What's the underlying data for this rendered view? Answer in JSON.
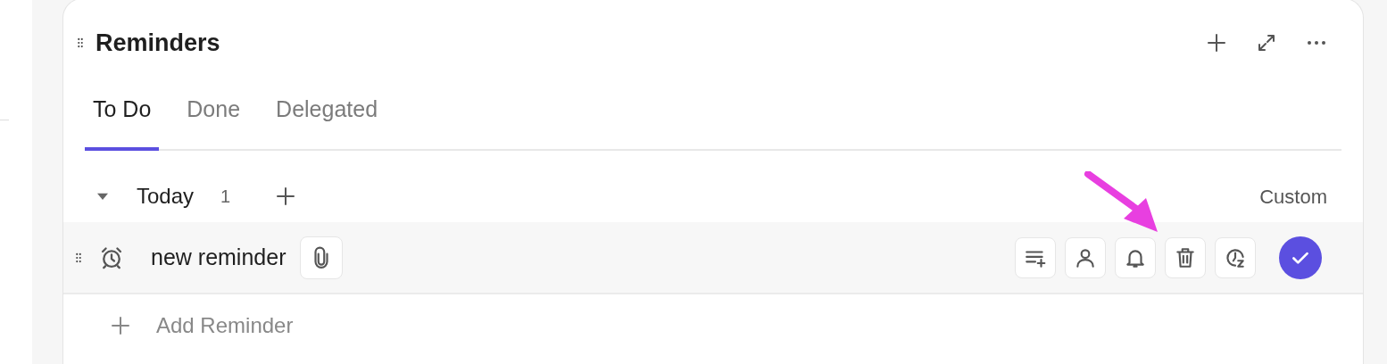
{
  "panel": {
    "title": "Reminders"
  },
  "tabs": [
    {
      "label": "To Do",
      "selected": true
    },
    {
      "label": "Done",
      "selected": false
    },
    {
      "label": "Delegated",
      "selected": false
    }
  ],
  "groups": [
    {
      "label": "Today",
      "count": "1",
      "expanded": true,
      "filter": "Custom",
      "reminders": [
        {
          "title": "new reminder"
        }
      ]
    }
  ],
  "add_label": "Add Reminder"
}
